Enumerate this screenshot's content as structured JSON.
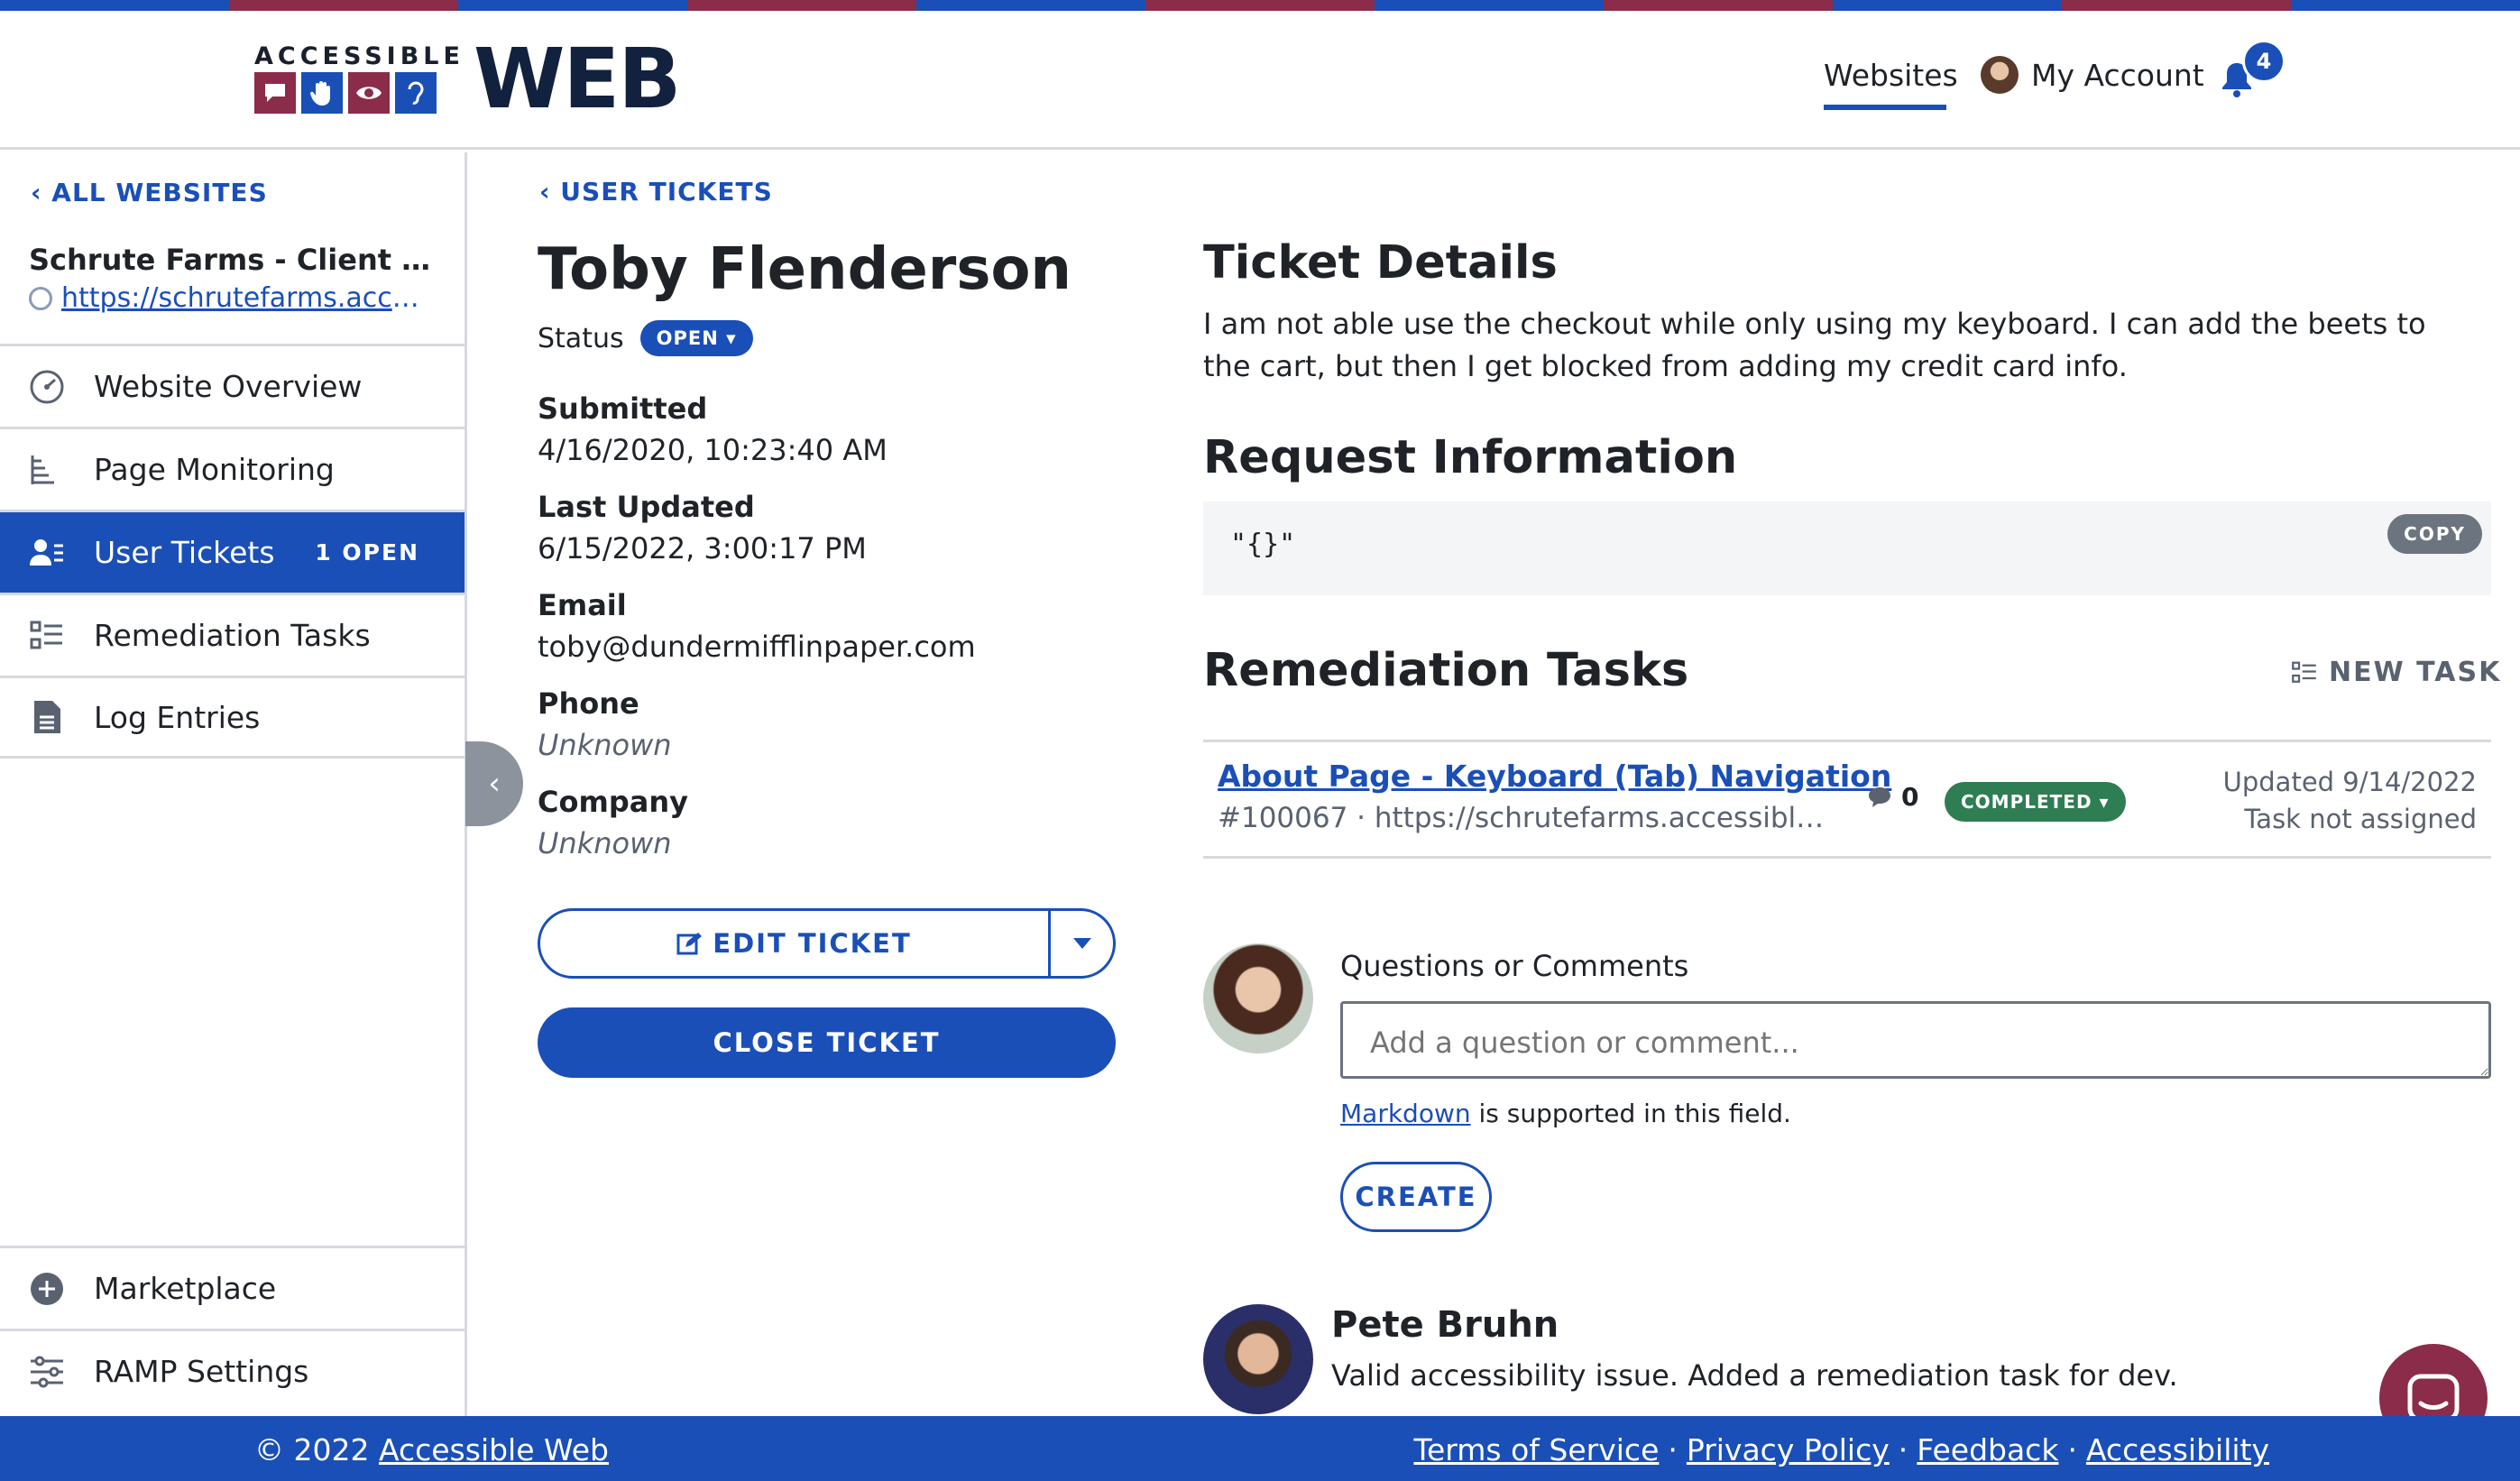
{
  "brand": {
    "small": "ACCESSIBLE",
    "big": "WEB",
    "colors": {
      "blue": "#1a4fb8",
      "maroon": "#8b2c4a",
      "green": "#2f7d52",
      "navy": "#12213d"
    }
  },
  "topnav": {
    "websites": "Websites",
    "account": "My Account",
    "notifications_count": "4"
  },
  "sidebar": {
    "back": "ALL WEBSITES",
    "site_name": "Schrute Farms - Client De...",
    "site_url": "https://schrutefarms.accessi...",
    "items": [
      {
        "label": "Website Overview",
        "icon": "gauge-icon"
      },
      {
        "label": "Page Monitoring",
        "icon": "tree-list-icon"
      },
      {
        "label": "User Tickets",
        "icon": "user-list-icon",
        "count": "1 OPEN"
      },
      {
        "label": "Remediation Tasks",
        "icon": "checklist-icon"
      },
      {
        "label": "Log Entries",
        "icon": "document-icon"
      }
    ],
    "bottom_items": [
      {
        "label": "Marketplace",
        "icon": "plus-circle-icon"
      },
      {
        "label": "RAMP Settings",
        "icon": "sliders-icon"
      }
    ]
  },
  "ticket": {
    "back": "USER TICKETS",
    "name": "Toby Flenderson",
    "status_label": "Status",
    "status": "OPEN",
    "fields": {
      "submitted_label": "Submitted",
      "submitted": "4/16/2020, 10:23:40 AM",
      "updated_label": "Last Updated",
      "updated": "6/15/2022, 3:00:17 PM",
      "email_label": "Email",
      "email": "toby@dundermifflinpaper.com",
      "phone_label": "Phone",
      "phone": "Unknown",
      "company_label": "Company",
      "company": "Unknown"
    },
    "edit_button": "EDIT TICKET",
    "close_button": "CLOSE TICKET"
  },
  "details": {
    "heading": "Ticket Details",
    "text": "I am not able use the checkout while only using my keyboard. I can add the beets to the cart, but then I get blocked from adding my credit card info."
  },
  "request": {
    "heading": "Request Information",
    "code": "\"{}\"",
    "copy": "COPY"
  },
  "tasks": {
    "heading": "Remediation Tasks",
    "new_task": "NEW TASK",
    "items": [
      {
        "title": "About Page - Keyboard (Tab) Navigation",
        "sub": "#100067 · https://schrutefarms.accessiblew...",
        "comments": "0",
        "status": "COMPLETED",
        "updated": "Updated 9/14/2022",
        "assigned": "Task not assigned"
      }
    ]
  },
  "comments": {
    "label": "Questions or Comments",
    "placeholder": "Add a question or comment...",
    "markdown_link": "Markdown",
    "markdown_note": " is supported in this field.",
    "create": "CREATE",
    "entries": [
      {
        "author": "Pete Bruhn",
        "text": "Valid accessibility issue. Added a remediation task for dev."
      }
    ]
  },
  "footer": {
    "copyright": "© 2022 ",
    "company_link": "Accessible Web",
    "links": [
      "Terms of Service",
      "Privacy Policy",
      "Feedback",
      "Accessibility"
    ],
    "separator": "·"
  }
}
